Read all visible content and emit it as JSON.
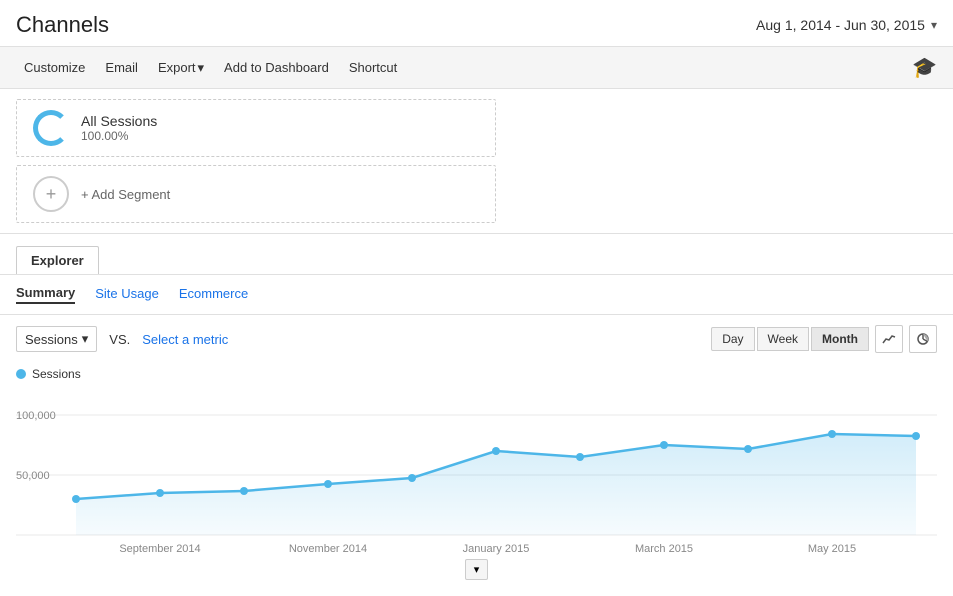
{
  "header": {
    "title": "Channels",
    "date_range": "Aug 1, 2014 - Jun 30, 2015"
  },
  "toolbar": {
    "customize": "Customize",
    "email": "Email",
    "export": "Export",
    "add_to_dashboard": "Add to Dashboard",
    "shortcut": "Shortcut"
  },
  "segment": {
    "name": "All Sessions",
    "percentage": "100.00%",
    "add_label": "+ Add Segment"
  },
  "tabs": {
    "explorer": "Explorer",
    "sub": [
      {
        "label": "Summary",
        "active": true,
        "link": false
      },
      {
        "label": "Site Usage",
        "active": false,
        "link": true
      },
      {
        "label": "Ecommerce",
        "active": false,
        "link": true
      }
    ]
  },
  "chart": {
    "metric": "Sessions",
    "vs_label": "VS.",
    "select_metric": "Select a metric",
    "legend_label": "Sessions",
    "periods": [
      "Day",
      "Week",
      "Month"
    ],
    "active_period": "Month",
    "y_labels": [
      "100,000",
      "50,000"
    ],
    "x_labels": [
      "September 2014",
      "November 2014",
      "January 2015",
      "March 2015",
      "May 2015"
    ]
  }
}
